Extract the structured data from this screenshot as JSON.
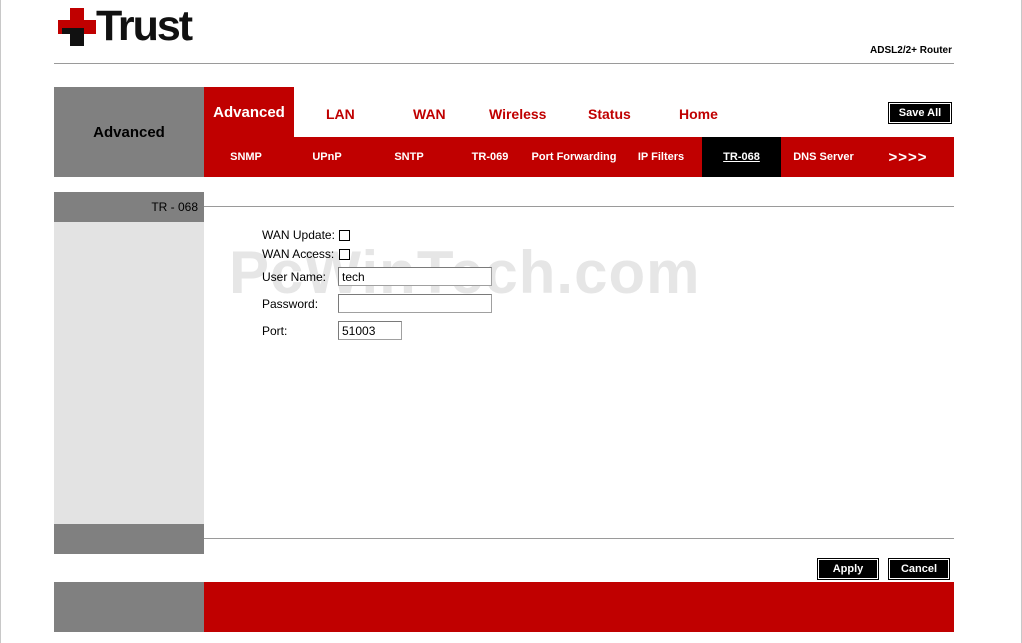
{
  "brand": {
    "name": "Trust",
    "accent": "#c00000",
    "mark_colors": [
      "#c00000",
      "#000000"
    ]
  },
  "product": "ADSL2/2+ Router",
  "side_title": "Advanced",
  "nav": {
    "active": "Advanced",
    "items": [
      "LAN",
      "WAN",
      "Wireless",
      "Status",
      "Home"
    ],
    "save_all": "Save All"
  },
  "subnav": {
    "items": [
      "SNMP",
      "UPnP",
      "SNTP",
      "TR-069",
      "Port Forwarding",
      "IP Filters",
      "TR-068",
      "DNS Server"
    ],
    "active": "TR-068",
    "more": ">>>>"
  },
  "sidebar": {
    "heading": "TR - 068"
  },
  "form": {
    "wan_update": {
      "label": "WAN Update:",
      "checked": false
    },
    "wan_access": {
      "label": "WAN Access:",
      "checked": false
    },
    "user_name": {
      "label": "User Name:",
      "value": "tech"
    },
    "password": {
      "label": "Password:",
      "value": ""
    },
    "port": {
      "label": "Port:",
      "value": "51003"
    }
  },
  "watermark": "PcWinTech.com",
  "buttons": {
    "apply": "Apply",
    "cancel": "Cancel"
  }
}
